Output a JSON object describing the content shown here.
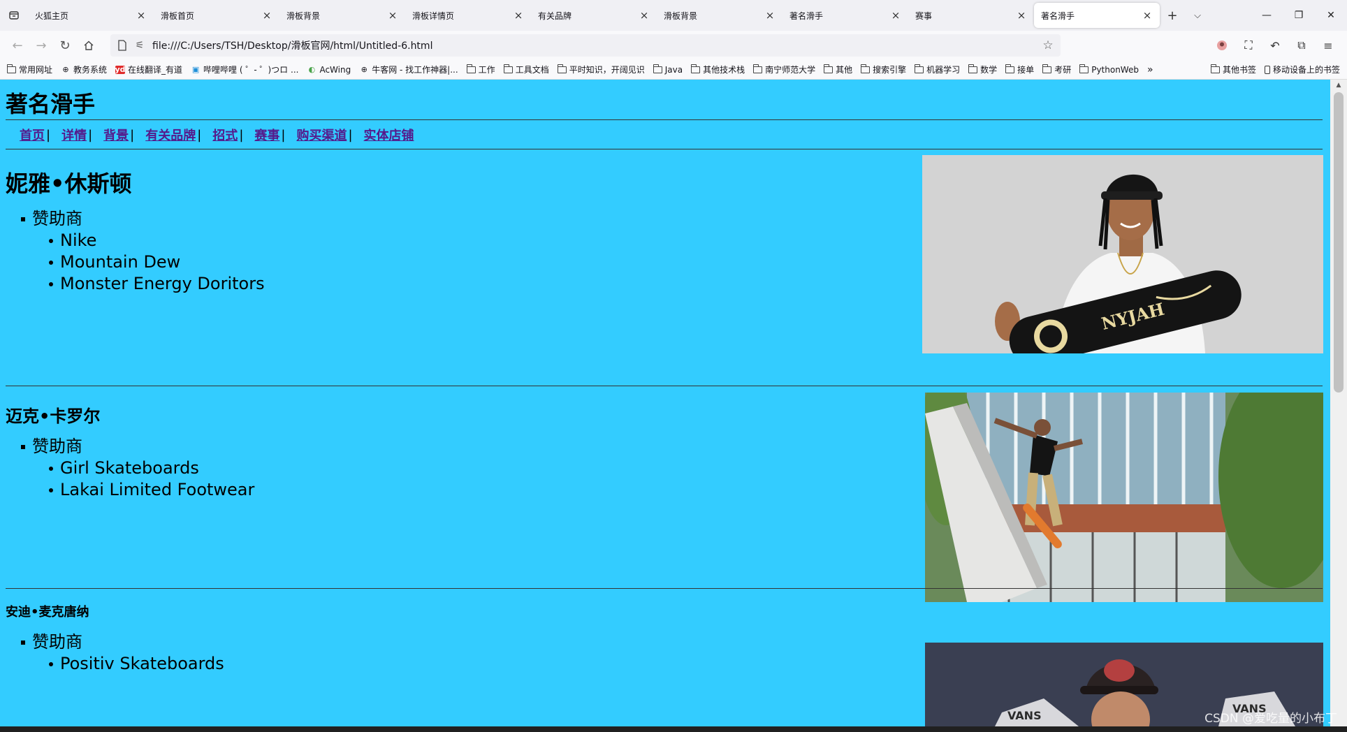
{
  "browser": {
    "tabs": [
      {
        "label": "火狐主页",
        "active": false
      },
      {
        "label": "滑板首页",
        "active": false
      },
      {
        "label": "滑板背景",
        "active": false
      },
      {
        "label": "滑板详情页",
        "active": false
      },
      {
        "label": "有关品牌",
        "active": false
      },
      {
        "label": "滑板背景",
        "active": false
      },
      {
        "label": "著名滑手",
        "active": false
      },
      {
        "label": "赛事",
        "active": false
      },
      {
        "label": "著名滑手",
        "active": true
      }
    ],
    "url": "file:///C:/Users/TSH/Desktop/滑板官网/html/Untitled-6.html",
    "bookmarks": [
      {
        "label": "常用网址",
        "icon": "folder-icon"
      },
      {
        "label": "教务系统",
        "icon": "globe-icon"
      },
      {
        "label": "在线翻译_有道",
        "icon": "youdao-icon"
      },
      {
        "label": "哔哩哔哩 ( ゜- ゜)つロ ...",
        "icon": "bilibili-icon"
      },
      {
        "label": "AcWing",
        "icon": "acwing-icon"
      },
      {
        "label": "牛客网 - 找工作神器|...",
        "icon": "globe-icon"
      },
      {
        "label": "工作",
        "icon": "folder-icon"
      },
      {
        "label": "工具文档",
        "icon": "folder-icon"
      },
      {
        "label": "平时知识，开阔见识",
        "icon": "folder-icon"
      },
      {
        "label": "Java",
        "icon": "folder-icon"
      },
      {
        "label": "其他技术栈",
        "icon": "folder-icon"
      },
      {
        "label": "南宁师范大学",
        "icon": "folder-icon"
      },
      {
        "label": "其他",
        "icon": "folder-icon"
      },
      {
        "label": "搜索引擎",
        "icon": "folder-icon"
      },
      {
        "label": "机器学习",
        "icon": "folder-icon"
      },
      {
        "label": "数学",
        "icon": "folder-icon"
      },
      {
        "label": "接单",
        "icon": "folder-icon"
      },
      {
        "label": "考研",
        "icon": "folder-icon"
      },
      {
        "label": "PythonWeb",
        "icon": "folder-icon"
      }
    ],
    "bookmarks_overflow": "»",
    "bookmarks_other": "其他书签",
    "bookmarks_mobile": "移动设备上的书签"
  },
  "page": {
    "title": "著名滑手",
    "nav": [
      "首页",
      "详情",
      "背景",
      "有关品牌",
      "招式",
      "赛事",
      "购买渠道",
      "实体店铺"
    ],
    "nav_separator": "|",
    "players": [
      {
        "name": "妮雅•休斯顿",
        "list_title": "赞助商",
        "sponsors": [
          "Nike",
          "Mountain Dew",
          "Monster Energy Doritors"
        ]
      },
      {
        "name": "迈克•卡罗尔",
        "list_title": "赞助商",
        "sponsors": [
          "Girl Skateboards",
          "Lakai Limited Footwear"
        ]
      },
      {
        "name": "安迪•麦克唐纳",
        "list_title": "赞助商",
        "sponsors": [
          "Positiv Skateboards"
        ]
      }
    ]
  },
  "watermark": "CSDN @爱吃量的小布丁",
  "colors": {
    "page_background": "#33ccff",
    "visited_link": "#551a8b"
  }
}
